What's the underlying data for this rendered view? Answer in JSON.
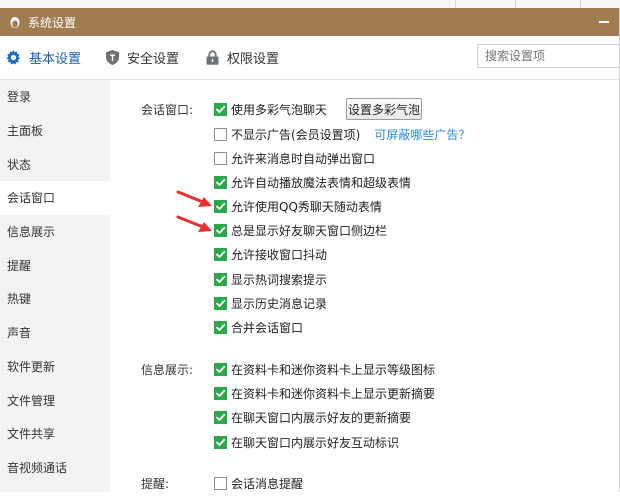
{
  "window": {
    "title": "系统设置"
  },
  "tabs": [
    {
      "label": "基本设置",
      "icon": "gear-icon",
      "active": true
    },
    {
      "label": "安全设置",
      "icon": "shield-icon",
      "active": false
    },
    {
      "label": "权限设置",
      "icon": "lock-icon",
      "active": false
    }
  ],
  "search": {
    "placeholder": "搜索设置项"
  },
  "sidebar": {
    "items": [
      {
        "label": "登录"
      },
      {
        "label": "主面板"
      },
      {
        "label": "状态"
      },
      {
        "label": "会话窗口"
      },
      {
        "label": "信息展示"
      },
      {
        "label": "提醒"
      },
      {
        "label": "热键"
      },
      {
        "label": "声音"
      },
      {
        "label": "软件更新"
      },
      {
        "label": "文件管理"
      },
      {
        "label": "文件共享"
      },
      {
        "label": "音视频通话"
      }
    ],
    "active_index": 3
  },
  "session_window": {
    "label": "会话窗口:",
    "bubble_button": "设置多彩气泡",
    "options": [
      {
        "label": "使用多彩气泡聊天",
        "checked": true
      },
      {
        "label": "不显示广告(会员设置项)",
        "checked": false,
        "link": "可屏蔽哪些广告？"
      },
      {
        "label": "允许来消息时自动弹出窗口",
        "checked": false
      },
      {
        "label": "允许自动播放魔法表情和超级表情",
        "checked": true
      },
      {
        "label": "允许使用QQ秀聊天随动表情",
        "checked": true
      },
      {
        "label": "总是显示好友聊天窗口侧边栏",
        "checked": true
      },
      {
        "label": "允许接收窗口抖动",
        "checked": true
      },
      {
        "label": "显示热词搜索提示",
        "checked": true
      },
      {
        "label": "显示历史消息记录",
        "checked": true
      },
      {
        "label": "合并会话窗口",
        "checked": true
      }
    ]
  },
  "info_display": {
    "label": "信息展示:",
    "options": [
      {
        "label": "在资料卡和迷你资料卡上显示等级图标",
        "checked": true
      },
      {
        "label": "在资料卡和迷你资料卡上显示更新摘要",
        "checked": true
      },
      {
        "label": "在聊天窗口内展示好友的更新摘要",
        "checked": true
      },
      {
        "label": "在聊天窗口内展示好友互动标识",
        "checked": true
      }
    ]
  },
  "reminder": {
    "label": "提醒:",
    "options": [
      {
        "label": "会话消息提醒",
        "checked": false
      }
    ]
  },
  "colors": {
    "titlebar": "#a07c50",
    "active_tab": "#1f5fa9",
    "checkbox_checked": "#2aa84a",
    "link": "#2a8de0",
    "annotation_arrow": "#e8322e"
  }
}
